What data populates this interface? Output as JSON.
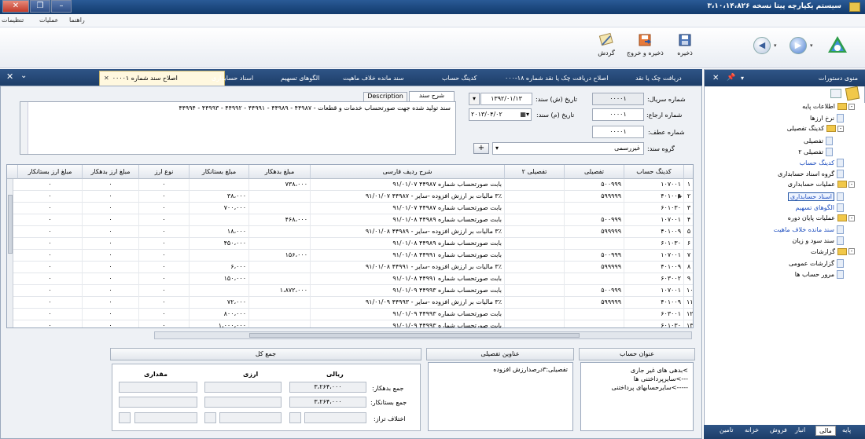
{
  "window": {
    "title": "سیستم یکپارچه پیتا نسخه ۳،۱۰،۱۴،۸۲۶"
  },
  "menu": {
    "items": [
      "تنظیمات",
      "عملیات",
      "راهنما"
    ]
  },
  "toolbar": {
    "save": "ذخیره",
    "save_exit": "ذخیره و خروج",
    "rotate": "گردش"
  },
  "tabs": [
    {
      "label": "دریافت چک یا نقد"
    },
    {
      "label": "اصلاح دریافت چک یا نقد شماره ۱۸-۰۰۰"
    },
    {
      "label": "کدینگ حساب"
    },
    {
      "label": "سند مانده خلاف ماهیت"
    },
    {
      "label": "الگوهای تسهیم"
    },
    {
      "label": "اسناد حسابداری"
    },
    {
      "label": "اصلاح سند شماره ۰۰۰۰۱"
    }
  ],
  "form": {
    "serial_label": "شماره سریال:",
    "serial_value": "۰۰۰۰۱",
    "date_sh_label": "تاریخ (ش) سند:",
    "date_sh_value": "۱۳۹۲/۰۱/۱۳",
    "ref_label": "شماره ارجاع:",
    "ref_value": "۰۰۰۰۱",
    "date_m_label": "تاریخ (م) سند:",
    "date_m_value": "۲۰۱۳/۰۴/۰۲",
    "atf_label": "شماره عطف:",
    "atf_value": "۰۰۰۰۱",
    "group_label": "گروه سند:",
    "group_value": "غیررسمی",
    "add_btn": "+",
    "desc_tab_fa": "شرح سند",
    "desc_tab_en": "Description",
    "desc_text": "سند تولید شده جهت صورتحساب خدمات و قطعات - ۴۴۹۸۷ - ۴۴۹۸۹ - ۴۴۹۹۱ - ۴۴۹۹۲ - ۴۴۹۹۳ - ۴۴۹۹۴"
  },
  "grid": {
    "headers": [
      "کدینگ حساب",
      "تفصیلی",
      "تفصیلی ۲",
      "شرح ردیف فارسی",
      "مبلغ بدهکار",
      "مبلغ بستانکار",
      "نوع ارز",
      "مبلغ ارز بدهکار",
      "مبلغ ارز بستانکار"
    ],
    "rows": [
      {
        "n": "۱",
        "code": "۱۰۷۰۰۱",
        "taf": "۵۰۰۹۹۹",
        "desc": "بابت صورتحساب شماره ۴۴۹۸۷ ۹۱/۰۱/۰۷",
        "deb": "۷۳۸،۰۰۰",
        "cred": "",
        "fx": "۰",
        "fd": "۰",
        "fc": "۰"
      },
      {
        "n": "۲",
        "code": "۴۰۱۰۰۹",
        "taf": "۵۹۹۹۹۹",
        "desc": "۳٪ مالیات بر ارزش افزوده -سایر - ۴۴۹۸۷ ۹۱/۰۱/۰۷",
        "deb": "",
        "cred": "۳۸،۰۰۰",
        "fx": "۰",
        "fd": "۰",
        "fc": "۰"
      },
      {
        "n": "۳",
        "code": "۶۰۱۰۳۰",
        "taf": "",
        "desc": "بابت صورتحساب شماره ۴۴۹۸۷ ۹۱/۰۱/۰۷",
        "deb": "",
        "cred": "۷۰۰،۰۰۰",
        "fx": "۰",
        "fd": "۰",
        "fc": "۰"
      },
      {
        "n": "۴",
        "code": "۱۰۷۰۰۱",
        "taf": "۵۰۰۹۹۹",
        "desc": "بابت صورتحساب شماره ۴۴۹۸۹ ۹۱/۰۱/۰۸",
        "deb": "۴۶۸،۰۰۰",
        "cred": "",
        "fx": "۰",
        "fd": "۰",
        "fc": "۰"
      },
      {
        "n": "۵",
        "code": "۴۰۱۰۰۹",
        "taf": "۵۹۹۹۹۹",
        "desc": "۳٪ مالیات بر ارزش افزوده -سایر - ۴۴۹۸۹ ۹۱/۰۱/۰۸",
        "deb": "",
        "cred": "۱۸،۰۰۰",
        "fx": "۰",
        "fd": "۰",
        "fc": "۰"
      },
      {
        "n": "۶",
        "code": "۶۰۱۰۳۰",
        "taf": "",
        "desc": "بابت صورتحساب شماره ۴۴۹۸۹ ۹۱/۰۱/۰۸",
        "deb": "",
        "cred": "۴۵۰،۰۰۰",
        "fx": "۰",
        "fd": "۰",
        "fc": "۰"
      },
      {
        "n": "۷",
        "code": "۱۰۷۰۰۱",
        "taf": "۵۰۰۹۹۹",
        "desc": "بابت صورتحساب شماره ۴۴۹۹۱ ۹۱/۰۱/۰۸",
        "deb": "۱۵۶،۰۰۰",
        "cred": "",
        "fx": "۰",
        "fd": "۰",
        "fc": "۰"
      },
      {
        "n": "۸",
        "code": "۴۰۱۰۰۹",
        "taf": "۵۹۹۹۹۹",
        "desc": "۳٪ مالیات بر ارزش افزوده -سایر - ۴۴۹۹۱ ۹۱/۰۱/۰۸",
        "deb": "",
        "cred": "۶،۰۰۰",
        "fx": "۰",
        "fd": "۰",
        "fc": "۰"
      },
      {
        "n": "۹",
        "code": "۶۰۳۰۰۲",
        "taf": "",
        "desc": "بابت صورتحساب شماره ۴۴۹۹۱ ۹۱/۰۱/۰۸",
        "deb": "",
        "cred": "۱۵۰،۰۰۰",
        "fx": "۰",
        "fd": "۰",
        "fc": "۰"
      },
      {
        "n": "۱۰",
        "code": "۱۰۷۰۰۱",
        "taf": "۵۰۰۹۹۹",
        "desc": "بابت صورتحساب شماره ۴۴۹۹۳ ۹۱/۰۱/۰۹",
        "deb": "۱،۸۷۲،۰۰۰",
        "cred": "",
        "fx": "۰",
        "fd": "۰",
        "fc": "۰"
      },
      {
        "n": "۱۱",
        "code": "۴۰۱۰۰۹",
        "taf": "۵۹۹۹۹۹",
        "desc": "۳٪ مالیات بر ارزش افزوده -سایر - ۴۴۹۹۳ ۹۱/۰۱/۰۹",
        "deb": "",
        "cred": "۷۲،۰۰۰",
        "fx": "۰",
        "fd": "۰",
        "fc": "۰"
      },
      {
        "n": "۱۲",
        "code": "۶۰۳۰۰۱",
        "taf": "",
        "desc": "بابت صورتحساب شماره ۴۴۹۹۳ ۹۱/۰۱/۰۹",
        "deb": "",
        "cred": "۸۰۰،۰۰۰",
        "fx": "۰",
        "fd": "۰",
        "fc": "۰"
      },
      {
        "n": "۱۳",
        "code": "۶۰۱۰۳۰",
        "taf": "",
        "desc": "بابت صورتحساب شماره ۴۴۹۹۳ ۹۱/۰۱/۰۹",
        "deb": "",
        "cred": "۱،۰۰۰،۰۰۰",
        "fx": "۰",
        "fd": "۰",
        "fc": "۰"
      }
    ]
  },
  "bottom": {
    "account_title_head": "عنوان حساب",
    "account_title_lines": [
      ">بدهی های غیر جاری",
      "--->سایرپرداختنی ها",
      "----->سایرحسابهای پرداختنی"
    ],
    "detail_head": "عناوین تفصیلی",
    "detail_text": "تفصیلی:۳درصدارزش افزوده",
    "sum_head": "جمع کل",
    "col_rial": "ریالی",
    "col_fx": "ارزی",
    "col_qty": "مقداری",
    "sum_deb_label": "جمع بدهکار:",
    "sum_deb_value": "۳،۲۶۴،۰۰۰",
    "sum_cred_label": "جمع بستانکار:",
    "sum_cred_value": "۳،۲۶۴،۰۰۰",
    "diff_label": "اختلاف تراز:"
  },
  "right_panel": {
    "title": "منوی دستورات",
    "tree": [
      {
        "label": "اطلاعات پایه",
        "lvl": 0,
        "type": "folder",
        "exp": "-"
      },
      {
        "label": "نرخ ارزها",
        "lvl": 1,
        "type": "doc"
      },
      {
        "label": "کدینگ تفصیلی",
        "lvl": 1,
        "type": "folder",
        "exp": "-"
      },
      {
        "label": "تفصیلی",
        "lvl": 2,
        "type": "doc"
      },
      {
        "label": "تفصیلی ۲",
        "lvl": 2,
        "type": "doc"
      },
      {
        "label": "کدینگ حساب",
        "lvl": 1,
        "type": "doc",
        "link": true
      },
      {
        "label": "گروه اسناد حسابداری",
        "lvl": 1,
        "type": "doc"
      },
      {
        "label": "عملیات حسابداری",
        "lvl": 0,
        "type": "folder",
        "exp": "-"
      },
      {
        "label": "اسناد حسابداری",
        "lvl": 1,
        "type": "doc",
        "selected": true
      },
      {
        "label": "الگوهای تسهیم",
        "lvl": 1,
        "type": "doc",
        "link": true
      },
      {
        "label": "عملیات پایان دوره",
        "lvl": 0,
        "type": "folder",
        "exp": "-"
      },
      {
        "label": "سند مانده خلاف ماهیت",
        "lvl": 1,
        "type": "doc",
        "link": true
      },
      {
        "label": "سند سود و زیان",
        "lvl": 1,
        "type": "doc"
      },
      {
        "label": "گزارشات",
        "lvl": 0,
        "type": "folder",
        "exp": "-"
      },
      {
        "label": "گزارشات عمومی",
        "lvl": 1,
        "type": "doc"
      },
      {
        "label": "مرور حساب ها",
        "lvl": 1,
        "type": "doc"
      }
    ],
    "bottom_tabs": [
      "پایه",
      "مالی",
      "انبار",
      "فروش",
      "خزانه",
      "تامین"
    ]
  }
}
